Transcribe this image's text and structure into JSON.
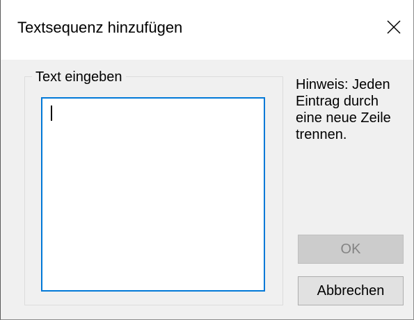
{
  "window": {
    "title": "Textsequenz hinzufügen",
    "close_icon": "close-icon"
  },
  "group": {
    "label": "Text eingeben"
  },
  "text_input": {
    "value": ""
  },
  "hint": {
    "text": "Hinweis: Jeden Eintrag durch eine neue Zeile trennen."
  },
  "buttons": {
    "ok_label": "OK",
    "ok_enabled": false,
    "cancel_label": "Abbrechen"
  },
  "colors": {
    "focus_border": "#0078d7",
    "client_background": "#f0f0f0"
  }
}
